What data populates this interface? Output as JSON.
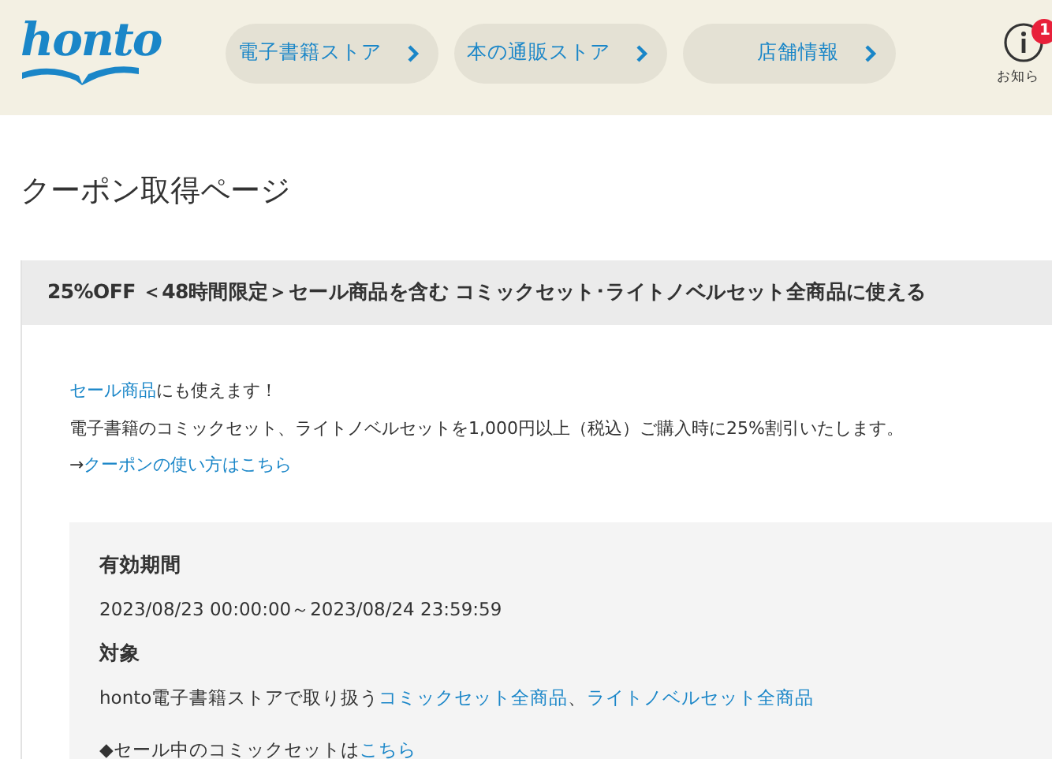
{
  "header": {
    "logo": "honto",
    "nav": [
      {
        "label": "電子書籍ストア"
      },
      {
        "label": "本の通販ストア"
      },
      {
        "label": "店舗情報"
      }
    ],
    "notice": {
      "badge": "1",
      "label": "お知ら"
    }
  },
  "page_title": "クーポン取得ページ",
  "coupon": {
    "title": "25%OFF ＜48時間限定＞セール商品を含む コミックセット･ライトノベルセット全商品に使える",
    "lead": [
      {
        "link": "セール商品",
        "text": "にも使えます！"
      }
    ],
    "description": "電子書籍のコミックセット、ライトノベルセットを1,000円以上（税込）ご購入時に25%割引いたします。",
    "howto": {
      "prefix": "→",
      "link": "クーポンの使い方はこちら"
    },
    "details": [
      {
        "heading": "有効期間",
        "parts": [
          {
            "text": "2023/08/23 00:00:00～2023/08/24 23:59:59",
            "link": false
          }
        ]
      },
      {
        "heading": "対象",
        "parts": [
          {
            "text": "honto電子書籍ストアで取り扱う",
            "link": false
          },
          {
            "text": "コミックセット全商品",
            "link": true
          },
          {
            "text": "、",
            "link": false
          },
          {
            "text": "ライトノベルセット全商品",
            "link": true
          }
        ]
      }
    ],
    "list_item": {
      "bullet": "◆",
      "text": "セール中のコミックセットは",
      "link": "こちら"
    }
  }
}
